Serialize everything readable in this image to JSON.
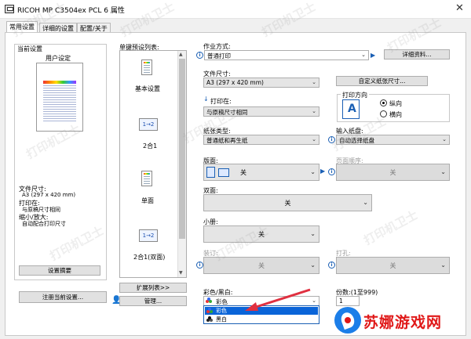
{
  "window": {
    "title": "RICOH MP C3504ex PCL 6 属性",
    "close": "✕"
  },
  "tabs": [
    {
      "label": "常用设置"
    },
    {
      "label": "详细的设置"
    },
    {
      "label": "配置/关于"
    }
  ],
  "current_settings": {
    "label": "当前设置",
    "user_setting": "用户设定",
    "paper_size_label": "文件尺寸:",
    "paper_size_value": "A3 (297 x 420 mm)",
    "print_on_label": "打印在:",
    "print_on_value": "与原稿尺寸相同",
    "reduce_label": "缩小/放大:",
    "reduce_value": "自动配合打印尺寸",
    "summary_button": "设置摘要",
    "register_button": "注册当前设置..."
  },
  "one_click": {
    "label": "单键预设列表:",
    "items": [
      {
        "label": "基本设置"
      },
      {
        "label": "2合1"
      },
      {
        "label": "单面"
      },
      {
        "label": "2合1(双面)"
      }
    ],
    "icon_text": "1→2",
    "expand_button": "扩展列表>>",
    "manage_button": "管理..."
  },
  "job_type": {
    "label": "作业方式:",
    "value": "普通打印",
    "details_button": "详细资料..."
  },
  "paper_size": {
    "label": "文件尺寸:",
    "value": "A3 (297 x 420 mm)",
    "custom_button": "自定义纸张尺寸..."
  },
  "print_on": {
    "label": "打印在:",
    "value": "与原稿尺寸相同"
  },
  "orientation": {
    "label": "打印方向",
    "portrait": "纵向",
    "landscape": "横向"
  },
  "paper_type": {
    "label": "纸张类型:",
    "value": "普通纸和再生纸"
  },
  "input_tray": {
    "label": "输入纸盘:",
    "value": "自动选择纸盘"
  },
  "sides": {
    "label": "版面:",
    "value": "关"
  },
  "page_order": {
    "label": "页面顺序:",
    "value": "关"
  },
  "duplex": {
    "label": "双面:",
    "value": "关"
  },
  "booklet": {
    "label": "小册:",
    "value": "关"
  },
  "staple": {
    "label": "装订:",
    "value": "关"
  },
  "punch": {
    "label": "打孔:",
    "value": "关"
  },
  "color": {
    "label": "彩色/黑白:",
    "value": "彩色",
    "options": [
      "彩色",
      "黑白"
    ]
  },
  "copies": {
    "label": "份数:(1至999)",
    "value": "1"
  },
  "watermarks": [
    "打印机卫士",
    "打印机卫士",
    "打印机卫士",
    "打印机卫士",
    "打印机卫士",
    "打印机卫士",
    "打印机卫士",
    "打印机卫士",
    "打印机卫士",
    "打印机卫士"
  ],
  "brand_logo": {
    "text": "苏娜游戏网"
  },
  "colors": {
    "accent": "#0a64d8",
    "arrow": "#e03040",
    "logo_bg": "#1c7ee8",
    "logo_text": "#e01818"
  }
}
